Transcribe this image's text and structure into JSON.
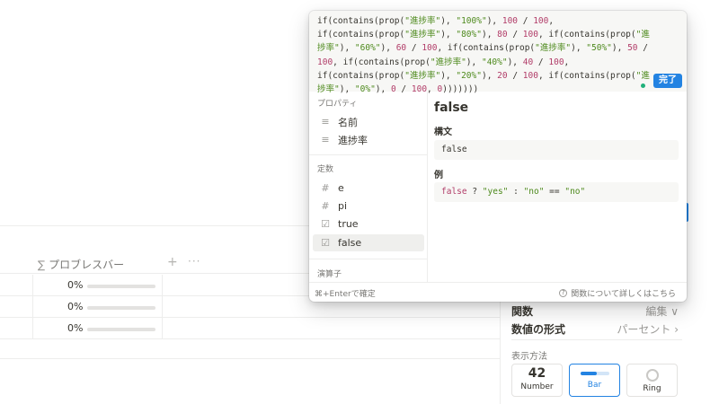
{
  "table": {
    "column_header": "プロブレスバー",
    "column_icon": "∑",
    "add_icon": "+",
    "more_icon": "···",
    "rows": [
      {
        "percent": "0%",
        "progress": 0
      },
      {
        "percent": "0%",
        "progress": 0
      },
      {
        "percent": "0%",
        "progress": 0
      }
    ]
  },
  "formula_editor": {
    "segments": [
      {
        "t": "if(contains(prop(",
        "c": ""
      },
      {
        "t": "\"進捗率\"",
        "c": "s"
      },
      {
        "t": "), ",
        "c": ""
      },
      {
        "t": "\"100%\"",
        "c": "s"
      },
      {
        "t": "), ",
        "c": ""
      },
      {
        "t": "100",
        "c": "n"
      },
      {
        "t": " / ",
        "c": ""
      },
      {
        "t": "100",
        "c": "n"
      },
      {
        "t": ",\nif(contains(prop(",
        "c": ""
      },
      {
        "t": "\"進捗率\"",
        "c": "s"
      },
      {
        "t": "), ",
        "c": ""
      },
      {
        "t": "\"80%\"",
        "c": "s"
      },
      {
        "t": "), ",
        "c": ""
      },
      {
        "t": "80",
        "c": "n"
      },
      {
        "t": " / ",
        "c": ""
      },
      {
        "t": "100",
        "c": "n"
      },
      {
        "t": ", if(contains(prop(",
        "c": ""
      },
      {
        "t": "\"進捗率\"",
        "c": "s"
      },
      {
        "t": "), ",
        "c": ""
      },
      {
        "t": "\"60%\"",
        "c": "s"
      },
      {
        "t": "), ",
        "c": ""
      },
      {
        "t": "60",
        "c": "n"
      },
      {
        "t": " / ",
        "c": ""
      },
      {
        "t": "100",
        "c": "n"
      },
      {
        "t": ", if(contains(prop(",
        "c": ""
      },
      {
        "t": "\"進捗率\"",
        "c": "s"
      },
      {
        "t": "), ",
        "c": ""
      },
      {
        "t": "\"50%\"",
        "c": "s"
      },
      {
        "t": "), ",
        "c": ""
      },
      {
        "t": "50",
        "c": "n"
      },
      {
        "t": " /\n",
        "c": ""
      },
      {
        "t": "100",
        "c": "n"
      },
      {
        "t": ", if(contains(prop(",
        "c": ""
      },
      {
        "t": "\"進捗率\"",
        "c": "s"
      },
      {
        "t": "), ",
        "c": ""
      },
      {
        "t": "\"40%\"",
        "c": "s"
      },
      {
        "t": "), ",
        "c": ""
      },
      {
        "t": "40",
        "c": "n"
      },
      {
        "t": " / ",
        "c": ""
      },
      {
        "t": "100",
        "c": "n"
      },
      {
        "t": ",\nif(contains(prop(",
        "c": ""
      },
      {
        "t": "\"進捗率\"",
        "c": "s"
      },
      {
        "t": "), ",
        "c": ""
      },
      {
        "t": "\"20%\"",
        "c": "s"
      },
      {
        "t": "), ",
        "c": ""
      },
      {
        "t": "20",
        "c": "n"
      },
      {
        "t": " / ",
        "c": ""
      },
      {
        "t": "100",
        "c": "n"
      },
      {
        "t": ", if(contains(prop(",
        "c": ""
      },
      {
        "t": "\"進捗率\"",
        "c": "s"
      },
      {
        "t": "), ",
        "c": ""
      },
      {
        "t": "\"0%\"",
        "c": "s"
      },
      {
        "t": "), ",
        "c": ""
      },
      {
        "t": "0",
        "c": "n"
      },
      {
        "t": " / ",
        "c": ""
      },
      {
        "t": "100",
        "c": "n"
      },
      {
        "t": ", ",
        "c": ""
      },
      {
        "t": "0",
        "c": "n"
      },
      {
        "t": ")))))))",
        "c": ""
      }
    ],
    "done_label": "完了",
    "status_color": "#20b07a"
  },
  "suggestions": {
    "properties_title": "プロパティ",
    "properties": [
      {
        "label": "名前",
        "icon": "text-icon"
      },
      {
        "label": "進捗率",
        "icon": "text-icon"
      }
    ],
    "constants_title": "定数",
    "constants": [
      {
        "label": "e",
        "icon": "hash-icon"
      },
      {
        "label": "pi",
        "icon": "hash-icon"
      },
      {
        "label": "true",
        "icon": "checkbox-icon"
      },
      {
        "label": "false",
        "icon": "checkbox-icon"
      }
    ],
    "operators_title": "演算子",
    "selected": "false"
  },
  "docs": {
    "title": "false",
    "syntax_heading": "構文",
    "syntax_code": "false",
    "example_heading": "例",
    "example": {
      "kw": "false",
      "op1": " ? ",
      "s1": "\"yes\"",
      "op2": " : ",
      "s2": "\"no\"",
      "op3": " == ",
      "s3": "\"no\""
    }
  },
  "footer": {
    "shortcut": "⌘+Enterで確定",
    "help_icon": "?",
    "help_link": "関数について詳しくはこちら"
  },
  "side_panel": {
    "functions_label": "関数",
    "functions_value": "編集 ∨",
    "number_format_label": "数値の形式",
    "number_format_value": "パーセント ›",
    "display_caption": "表示方法",
    "styles": [
      {
        "label": "Number",
        "preview": "42",
        "active": false
      },
      {
        "label": "Bar",
        "preview": "bar",
        "active": true
      },
      {
        "label": "Ring",
        "preview": "ring",
        "active": false
      }
    ]
  },
  "colors": {
    "accent": "#2383e2",
    "string": "#4e8a1d",
    "number": "#b13c68"
  }
}
